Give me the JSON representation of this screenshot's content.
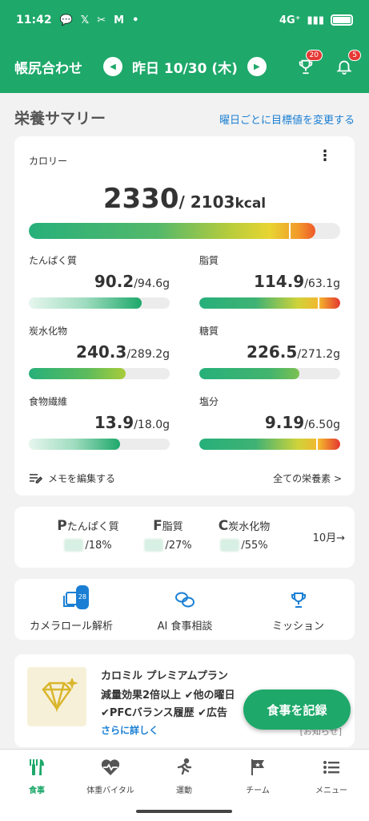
{
  "status_bar": {
    "time": "11:42",
    "network": "4G⁺"
  },
  "header": {
    "title": "帳尻合わせ",
    "date": "昨日 10/30 (木)",
    "trophy_badge": "20",
    "bell_badge": "5"
  },
  "summary": {
    "title": "栄養サマリー",
    "change_link": "曜日ごとに目標値を変更する"
  },
  "calorie": {
    "label": "カロリー",
    "value": "2330",
    "target": "/ 2103",
    "unit": "kcal",
    "ratio": 0.92
  },
  "nutrients": [
    {
      "label": "たんぱく質",
      "value": "90.2",
      "target": "/94.6g",
      "ratio": 0.8
    },
    {
      "label": "脂質",
      "value": "114.9",
      "target": "/63.1g",
      "ratio": 1.0
    },
    {
      "label": "炭水化物",
      "value": "240.3",
      "target": "/289.2g",
      "ratio": 0.69
    },
    {
      "label": "糖質",
      "value": "226.5",
      "target": "/271.2g",
      "ratio": 0.71
    },
    {
      "label": "食物繊維",
      "value": "13.9",
      "target": "/18.0g",
      "ratio": 0.65
    },
    {
      "label": "塩分",
      "value": "9.19",
      "target": "/6.50g",
      "ratio": 1.0
    }
  ],
  "memo_label": "メモを編集する",
  "all_nutrients_link": "全ての栄養素 >",
  "pfc": {
    "protein": {
      "letter": "P",
      "label": "たんぱく質",
      "pct": "/18%"
    },
    "fat": {
      "letter": "F",
      "label": "脂質",
      "pct": "/27%"
    },
    "carb": {
      "letter": "C",
      "label": "炭水化物",
      "pct": "/55%"
    },
    "month_link": "10月→"
  },
  "quick_actions": {
    "camera": {
      "label": "カメラロール解析",
      "badge": "28"
    },
    "ai": {
      "label": "AI 食事相談"
    },
    "mission": {
      "label": "ミッション"
    }
  },
  "premium": {
    "title": "カロミル プレミアムプラン",
    "line1": "減量効果2倍以上 ✔他の曜日",
    "line2": "✔PFCバランス履歴 ✔広告",
    "more": "さらに詳しく",
    "tag": "[お知らせ]"
  },
  "fab_label": "食事を記録",
  "bottom_nav": [
    {
      "label": "食事",
      "icon": "fork-knife-icon"
    },
    {
      "label": "体重バイタル",
      "icon": "heart-pulse-icon"
    },
    {
      "label": "運動",
      "icon": "runner-icon"
    },
    {
      "label": "チーム",
      "icon": "flag-icon"
    },
    {
      "label": "メニュー",
      "icon": "menu-list-icon"
    }
  ],
  "colors": {
    "brand_green": "#1ea86a",
    "link_blue": "#1a7fd4",
    "badge_red": "#e53935"
  }
}
